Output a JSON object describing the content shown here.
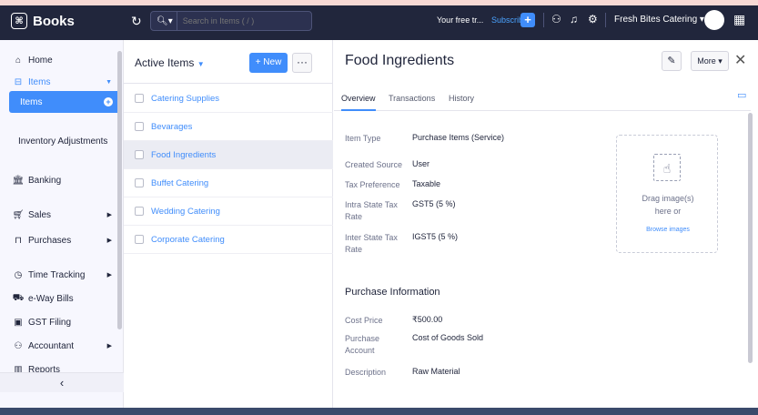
{
  "topbar": {
    "app_name": "Books",
    "search_placeholder": "Search in Items ( / )",
    "trial_text": "Your free tr...",
    "subscribe_label": "Subscribe",
    "org_name": "Fresh Bites Catering"
  },
  "sidebar": {
    "home": "Home",
    "items": "Items",
    "items_active": "Items",
    "inventory_adjustments": "Inventory Adjustments",
    "banking": "Banking",
    "sales": "Sales",
    "purchases": "Purchases",
    "time_tracking": "Time Tracking",
    "eway_bills": "e-Way Bills",
    "gst_filing": "GST Filing",
    "accountant": "Accountant",
    "reports": "Reports",
    "collapse": "‹"
  },
  "list": {
    "title": "Active Items",
    "new_label": "+ New",
    "items": [
      "Catering Supplies",
      "Bevarages",
      "Food Ingredients",
      "Buffet Catering",
      "Wedding Catering",
      "Corporate Catering"
    ]
  },
  "detail": {
    "title": "Food Ingredients",
    "more_label": "More",
    "tabs": [
      "Overview",
      "Transactions",
      "History"
    ],
    "fields": {
      "item_type_label": "Item Type",
      "item_type": "Purchase Items (Service)",
      "created_source_label": "Created Source",
      "created_source": "User",
      "tax_pref_label": "Tax Preference",
      "tax_pref": "Taxable",
      "intra_label": "Intra State Tax Rate",
      "intra": "GST5 (5 %)",
      "inter_label": "Inter State Tax Rate",
      "inter": "IGST5 (5 %)"
    },
    "purchase_section": "Purchase Information",
    "purchase": {
      "cost_price_label": "Cost Price",
      "cost_price": "₹500.00",
      "account_label": "Purchase Account",
      "account": "Cost of Goods Sold",
      "description_label": "Description",
      "description": "Raw Material"
    },
    "dropzone": {
      "line1": "Drag image(s)",
      "line2": "here or",
      "link": "Browse images"
    }
  }
}
